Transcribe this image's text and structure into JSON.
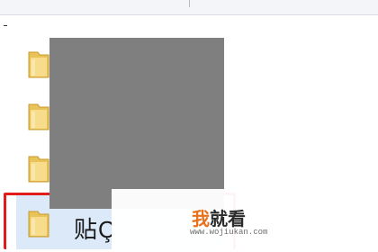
{
  "file_list": {
    "folders": [
      {
        "icon": "folder-icon"
      },
      {
        "icon": "folder-icon"
      },
      {
        "icon": "folder-icon"
      }
    ],
    "selected_item": {
      "icon": "folder-icon",
      "label_partial": "贴Ç"
    }
  },
  "overlay": {
    "color": "#7f7f7f"
  },
  "highlight": {
    "color": "#e21b1b"
  },
  "watermark": {
    "title_first_char": "我",
    "title_rest": "就看",
    "url": "www.wojiukan.com",
    "accent_color": "#e8711c"
  }
}
